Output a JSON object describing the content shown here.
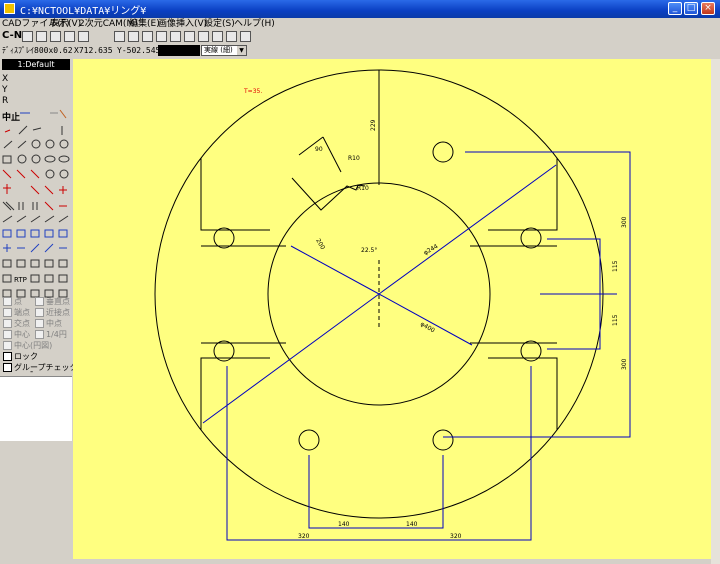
{
  "window": {
    "title": "C:¥NCTOOL¥DATA¥リング¥",
    "buttons": [
      "_",
      "□",
      "×"
    ]
  },
  "menu": [
    "CADファイル(F)",
    "表示(V)",
    "2次元CAM(M)",
    "編集(E)",
    "画像挿入(V)",
    "設定(S)",
    "ヘルプ(H)"
  ],
  "toolbar": {
    "mode_label": "C-N",
    "icons": [
      "zoom-icon",
      "grid-icon",
      "link-icon",
      "node-icon",
      "snap-icon",
      "file-new-icon",
      "open-icon",
      "folder-icon",
      "save-icon",
      "print-icon",
      "dxf-icon",
      "nc-icon",
      "dxf1-icon",
      "dxf2-icon",
      "sub-icon"
    ]
  },
  "coords": {
    "scale": "ﾃﾞｨｽﾌﾟﾚｲ800x0.62",
    "x": "X712.635",
    "y": "Y-502.545",
    "line_type": "実線 (細)"
  },
  "left": {
    "layer": "1:Default",
    "xyr": [
      "X",
      "Y",
      "R"
    ],
    "stop_label": "中止",
    "snap": [
      {
        "label": "点",
        "checked": true,
        "enabled": false
      },
      {
        "label": "垂直点",
        "checked": false,
        "enabled": false
      },
      {
        "label": "端点",
        "checked": true,
        "enabled": false
      },
      {
        "label": "近接点",
        "checked": false,
        "enabled": false
      },
      {
        "label": "交点",
        "checked": true,
        "enabled": false
      },
      {
        "label": "中点",
        "checked": false,
        "enabled": false
      },
      {
        "label": "中心",
        "checked": true,
        "enabled": false
      },
      {
        "label": "1/4円",
        "checked": false,
        "enabled": false
      },
      {
        "label": "中心(円図)",
        "checked": false,
        "enabled": false
      },
      {
        "label": "ロック",
        "checked": true,
        "enabled": true
      },
      {
        "label": "グループチェック",
        "checked": false,
        "enabled": true
      }
    ],
    "collapse": "-"
  },
  "drawing": {
    "thickness": "T=35.",
    "dims": [
      "229",
      "90",
      "R10",
      "R10",
      "200",
      "22.5°",
      "φ244",
      "φ400",
      "300",
      "115",
      "115",
      "300",
      "140",
      "140",
      "320",
      "320"
    ],
    "colors": {
      "canvas": "#ffff80",
      "geometry": "#000000",
      "dims": "#0000c0",
      "thickness": "#e00000"
    }
  }
}
